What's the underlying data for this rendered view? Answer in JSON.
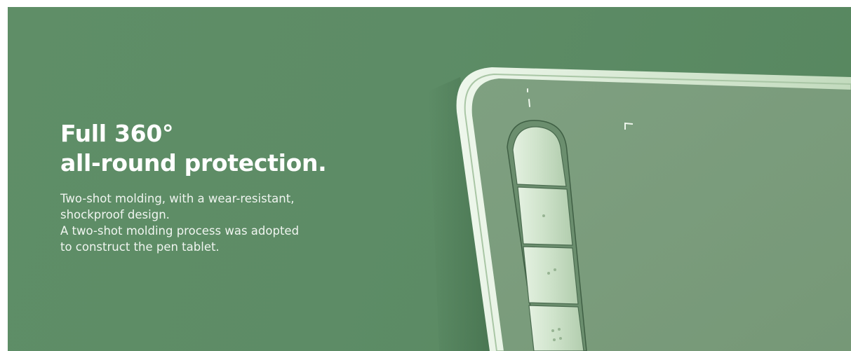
{
  "hero": {
    "headline_line1": "Full 360°",
    "headline_line2": "all-round protection.",
    "body_lines": [
      "Two-shot molding, with a wear-resistant,",
      "shockproof design.",
      "A two-shot molding process was adopted",
      "to construct the pen tablet."
    ]
  },
  "product": {
    "image": "pen-tablet-corner",
    "express_key_count": 4,
    "colors": {
      "background": "#5d8c66",
      "tablet_surface": "#7a9a7c",
      "tablet_frame": "#d9ead6",
      "keys": "#c9dfc4"
    }
  }
}
